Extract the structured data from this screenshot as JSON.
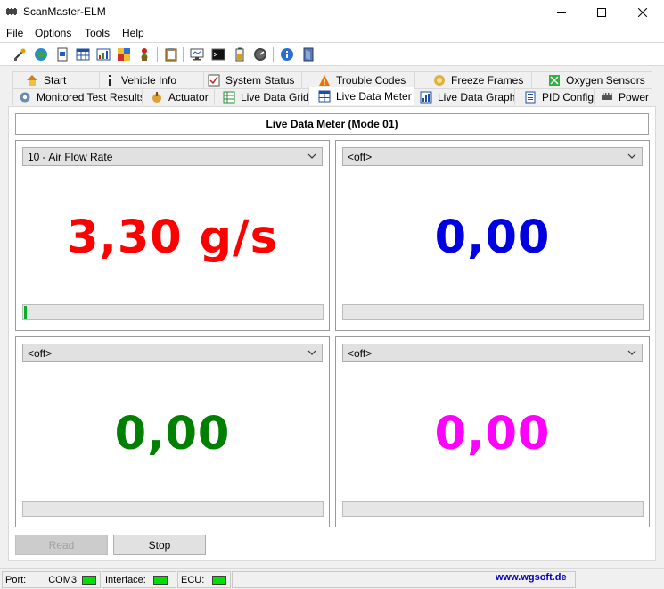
{
  "window": {
    "title": "ScanMaster-ELM"
  },
  "menu": [
    {
      "label": "File"
    },
    {
      "label": "Options"
    },
    {
      "label": "Tools"
    },
    {
      "label": "Help"
    }
  ],
  "toolbar_icons": [
    "connect-icon",
    "globe-icon",
    "document-icon",
    "table-icon",
    "chart-icon",
    "gauge-icon",
    "traffic-light-icon",
    "clipboard-icon",
    "monitor-icon",
    "terminal-icon",
    "battery-icon",
    "dial-icon",
    "info-icon",
    "exit-icon"
  ],
  "tabs_row1": [
    {
      "label": "Start",
      "icon": "house-icon"
    },
    {
      "label": "Vehicle Info",
      "icon": "info-icon"
    },
    {
      "label": "System Status",
      "icon": "checklist-icon"
    },
    {
      "label": "Trouble Codes",
      "icon": "warning-icon"
    },
    {
      "label": "Freeze Frames",
      "icon": "snowflake-icon"
    },
    {
      "label": "Oxygen Sensors",
      "icon": "sensor-icon"
    }
  ],
  "tabs_row2": [
    {
      "label": "Monitored Test Results",
      "icon": "gear-icon"
    },
    {
      "label": "Actuator",
      "icon": "actuator-icon"
    },
    {
      "label": "Live Data Grid",
      "icon": "grid-icon"
    },
    {
      "label": "Live Data Meter",
      "icon": "meter-icon",
      "active": true
    },
    {
      "label": "Live Data Graph",
      "icon": "graph-icon"
    },
    {
      "label": "PID Config",
      "icon": "config-icon"
    },
    {
      "label": "Power",
      "icon": "power-icon"
    }
  ],
  "header": {
    "title": "Live Data Meter (Mode 01)"
  },
  "meters": [
    {
      "selected": "10 - Air Flow Rate",
      "value": "3,30 g/s",
      "color": "#ff0000",
      "progress": 0.01
    },
    {
      "selected": "<off>",
      "value": "0,00",
      "color": "#0000e0",
      "progress": 0
    },
    {
      "selected": "<off>",
      "value": "0,00",
      "color": "#008000",
      "progress": 0
    },
    {
      "selected": "<off>",
      "value": "0,00",
      "color": "#ff00ff",
      "progress": 0
    }
  ],
  "buttons": {
    "read": "Read",
    "stop": "Stop"
  },
  "status": {
    "port_label": "Port:",
    "port_value": "COM3",
    "interface_label": "Interface:",
    "ecu_label": "ECU:",
    "link": "www.wgsoft.de"
  }
}
